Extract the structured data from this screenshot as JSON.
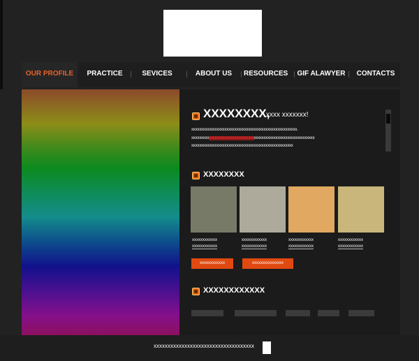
{
  "nav": {
    "items": [
      {
        "label": "OUR PROFILE",
        "active": true
      },
      {
        "label": "PRACTICE"
      },
      {
        "label": "SEVICES"
      },
      {
        "label": "ABOUT US"
      },
      {
        "label": "RESOURCES"
      },
      {
        "label": "GIF ALAWYER"
      },
      {
        "label": "CONTACTS"
      }
    ]
  },
  "welcome": {
    "title": "XXXXXXXX,",
    "subtitle": "xxxx xxxxxxx!",
    "line1": "xxxxxxxxxxxxxxxxxxxxxxxxxxxxxxxxxxxxxxxxxxxxxxxxxxxxxx.",
    "line2a": "xxxxxxxxx",
    "line2red": "xxxxxxxxxxxxxxxxxxxxxxx",
    "line2b": "xxxxxxxxxxxxxxxxxxxxxxxxxxxxxxx",
    "line3": "xxxxxxxxxxxxxxxxxxxxxxxxxxxxxxxxxxxxxxxxxxxxxxxxxxxx"
  },
  "section2": {
    "title": "XXXXXXXX",
    "tiles": [
      "#787a68",
      "#adaa9c",
      "#e0a860",
      "#c8b67a"
    ],
    "captions": [
      {
        "l1": "xxxxxxxxxxxx",
        "l2": "xxxxxxxxxxxx"
      },
      {
        "l1": "xxxxxxxxxxxx",
        "l2": "xxxxxxxxxxxx"
      },
      {
        "l1": "xxxxxxxxxxxx",
        "l2": "xxxxxxxxxxxx"
      },
      {
        "l1": "xxxxxxxxxxxx",
        "l2": "xxxxxxxxxxxx"
      }
    ],
    "button1": "xxxxxxxxxxxx",
    "button2": "xxxxxxxxxxxxxxx"
  },
  "section3": {
    "title": "XXXXXXXXXXXX"
  },
  "footer": {
    "text": "xxxxxxxxxxxxxxxxxxxxxxxxxxxxxxxxxxxx"
  },
  "colors": {
    "accent": "#e04a10",
    "nav_active": "#e8622a",
    "background": "#222222",
    "content_bg": "#1b1b1b"
  }
}
